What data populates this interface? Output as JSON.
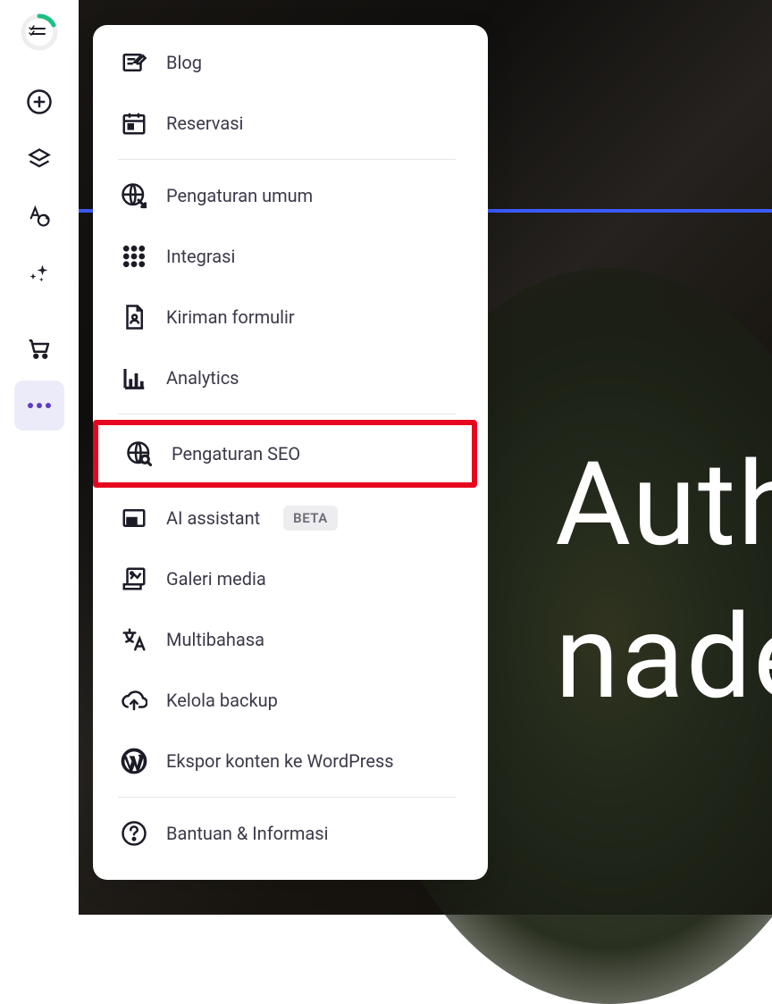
{
  "background": {
    "hero_text_line1": "Auth",
    "hero_text_line2": "nade"
  },
  "sidebar_icons": [
    {
      "name": "progress-ring-icon"
    },
    {
      "name": "add-icon"
    },
    {
      "name": "layers-icon"
    },
    {
      "name": "typography-palette-icon"
    },
    {
      "name": "sparkle-icon"
    },
    {
      "name": "cart-icon"
    },
    {
      "name": "more-icon"
    }
  ],
  "popup": {
    "groups": [
      {
        "items": [
          {
            "id": "blog",
            "label": "Blog",
            "icon": "blog-icon"
          },
          {
            "id": "reservation",
            "label": "Reservasi",
            "icon": "calendar-icon"
          }
        ]
      },
      {
        "items": [
          {
            "id": "general",
            "label": "Pengaturan umum",
            "icon": "globe-share-icon"
          },
          {
            "id": "integration",
            "label": "Integrasi",
            "icon": "grid-dots-icon"
          },
          {
            "id": "form",
            "label": "Kiriman formulir",
            "icon": "document-person-icon"
          },
          {
            "id": "analytics",
            "label": "Analytics",
            "icon": "bar-chart-icon"
          }
        ]
      },
      {
        "items": [
          {
            "id": "seo",
            "label": "Pengaturan SEO",
            "icon": "globe-search-icon",
            "highlight": true
          },
          {
            "id": "ai",
            "label": "AI assistant",
            "icon": "window-icon",
            "badge": "BETA"
          },
          {
            "id": "media",
            "label": "Galeri media",
            "icon": "image-stack-icon"
          },
          {
            "id": "multilang",
            "label": "Multibahasa",
            "icon": "translate-icon"
          },
          {
            "id": "backup",
            "label": "Kelola backup",
            "icon": "cloud-upload-icon"
          },
          {
            "id": "export",
            "label": "Ekspor konten ke WordPress",
            "icon": "wordpress-icon"
          }
        ]
      },
      {
        "items": [
          {
            "id": "help",
            "label": "Bantuan & Informasi",
            "icon": "help-icon"
          }
        ]
      }
    ]
  }
}
